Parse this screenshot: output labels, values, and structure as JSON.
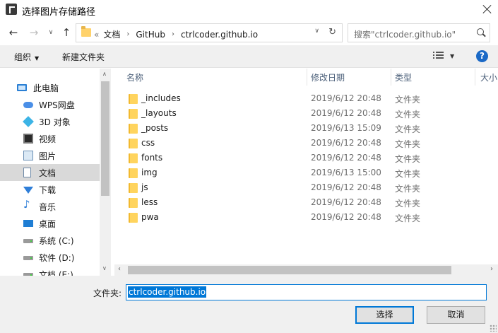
{
  "window": {
    "title": "选择图片存储路径"
  },
  "address": {
    "overflow": "«",
    "crumbs": [
      "文档",
      "GitHub",
      "ctrlcoder.github.io"
    ]
  },
  "search": {
    "placeholder": "搜索\"ctrlcoder.github.io\""
  },
  "toolbar": {
    "organize_label": "组织",
    "new_folder_label": "新建文件夹"
  },
  "nav": {
    "items": [
      {
        "label": "此电脑",
        "icon": "computer-icon"
      },
      {
        "label": "WPS网盘",
        "icon": "cloud-icon"
      },
      {
        "label": "3D 对象",
        "icon": "cube-icon"
      },
      {
        "label": "视频",
        "icon": "video-icon"
      },
      {
        "label": "图片",
        "icon": "picture-icon"
      },
      {
        "label": "文档",
        "icon": "document-icon",
        "selected": true
      },
      {
        "label": "下载",
        "icon": "download-icon"
      },
      {
        "label": "音乐",
        "icon": "music-icon"
      },
      {
        "label": "桌面",
        "icon": "desktop-icon"
      },
      {
        "label": "系统 (C:)",
        "icon": "drive-icon"
      },
      {
        "label": "软件 (D:)",
        "icon": "drive-icon"
      },
      {
        "label": "文档 (E:)",
        "icon": "drive-icon"
      }
    ]
  },
  "columns": {
    "name": "名称",
    "modified": "修改日期",
    "type": "类型",
    "size": "大小"
  },
  "files": [
    {
      "name": "_includes",
      "modified": "2019/6/12 20:48",
      "type": "文件夹"
    },
    {
      "name": "_layouts",
      "modified": "2019/6/12 20:48",
      "type": "文件夹"
    },
    {
      "name": "_posts",
      "modified": "2019/6/13 15:09",
      "type": "文件夹"
    },
    {
      "name": "css",
      "modified": "2019/6/12 20:48",
      "type": "文件夹"
    },
    {
      "name": "fonts",
      "modified": "2019/6/12 20:48",
      "type": "文件夹"
    },
    {
      "name": "img",
      "modified": "2019/6/13 15:00",
      "type": "文件夹"
    },
    {
      "name": "js",
      "modified": "2019/6/12 20:48",
      "type": "文件夹"
    },
    {
      "name": "less",
      "modified": "2019/6/12 20:48",
      "type": "文件夹"
    },
    {
      "name": "pwa",
      "modified": "2019/6/12 20:48",
      "type": "文件夹"
    }
  ],
  "footer": {
    "folder_label": "文件夹:",
    "folder_value": "ctrlcoder.github.io",
    "select_label": "选择",
    "cancel_label": "取消"
  },
  "colors": {
    "accent": "#0078d7",
    "selection": "#d9d9d9",
    "folder": "#ffd45e"
  }
}
